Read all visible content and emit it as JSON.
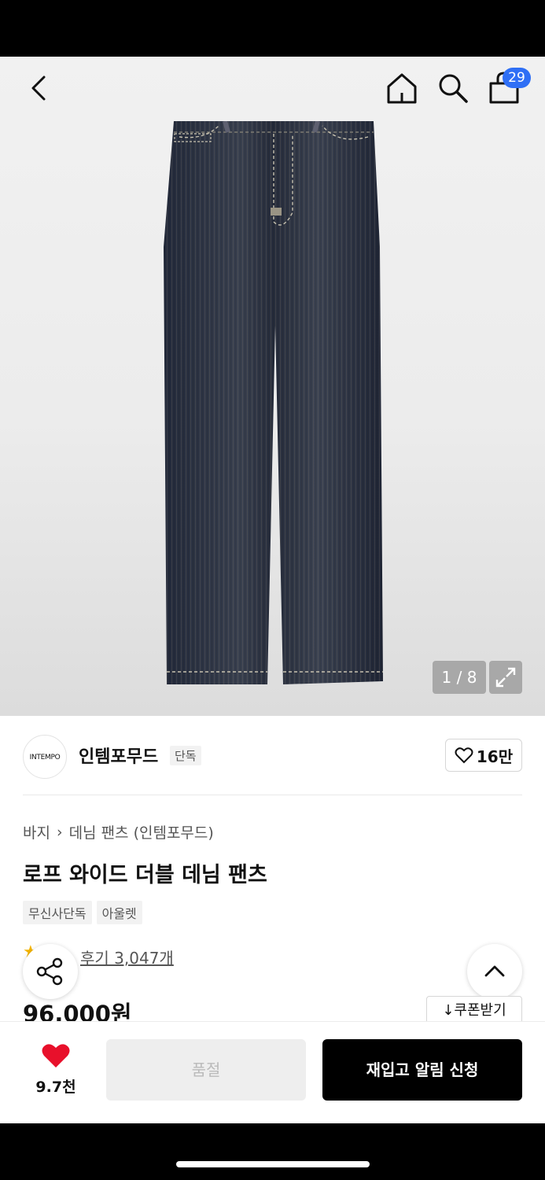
{
  "nav": {
    "back_icon": "chevron-left-icon",
    "home_icon": "home-icon",
    "search_icon": "search-icon",
    "cart_icon": "shopping-bag-icon",
    "cart_badge": "29"
  },
  "gallery": {
    "counter": "1 / 8",
    "expand_icon": "expand-icon"
  },
  "brand": {
    "logo_text": "INTEMPO",
    "name": "인템포무드",
    "tag": "단독",
    "likes": "16만"
  },
  "product": {
    "breadcrumb": [
      "바지",
      "데님 팬츠 (인템포무드)"
    ],
    "title": "로프 와이드 더블 데님 팬츠",
    "tags": [
      "무신사단독",
      "아울렛"
    ],
    "reviews": "후기 3,047개",
    "price": "96,000원",
    "coupon": "↓쿠폰받기"
  },
  "action_bar": {
    "wish_count": "9.7천",
    "soldout_label": "품절",
    "restock_label": "재입고 알림 신청"
  },
  "colors": {
    "badge": "#2f6ff5",
    "heart": "#e8102b",
    "primary_button": "#000000",
    "denim": "#2a3040"
  }
}
